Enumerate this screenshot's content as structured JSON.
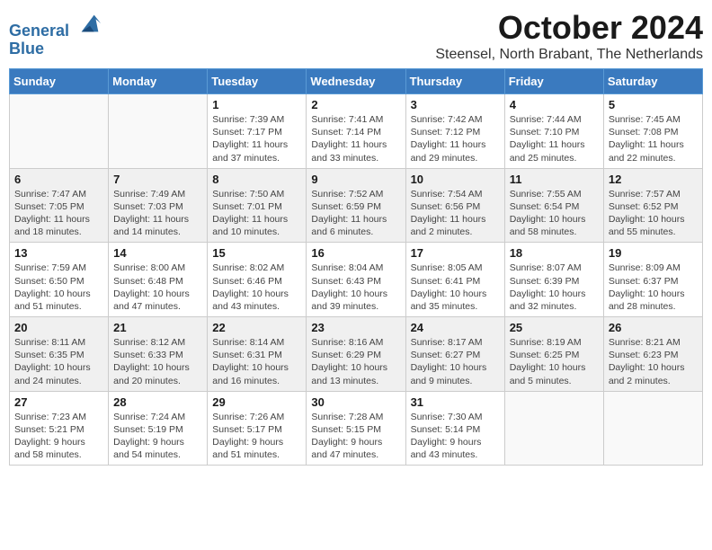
{
  "logo": {
    "line1": "General",
    "line2": "Blue"
  },
  "title": "October 2024",
  "location": "Steensel, North Brabant, The Netherlands",
  "days_of_week": [
    "Sunday",
    "Monday",
    "Tuesday",
    "Wednesday",
    "Thursday",
    "Friday",
    "Saturday"
  ],
  "weeks": [
    [
      {
        "day": "",
        "empty": true
      },
      {
        "day": "",
        "empty": true
      },
      {
        "day": "1",
        "rise": "7:39 AM",
        "set": "7:17 PM",
        "daylight": "11 hours and 37 minutes."
      },
      {
        "day": "2",
        "rise": "7:41 AM",
        "set": "7:14 PM",
        "daylight": "11 hours and 33 minutes."
      },
      {
        "day": "3",
        "rise": "7:42 AM",
        "set": "7:12 PM",
        "daylight": "11 hours and 29 minutes."
      },
      {
        "day": "4",
        "rise": "7:44 AM",
        "set": "7:10 PM",
        "daylight": "11 hours and 25 minutes."
      },
      {
        "day": "5",
        "rise": "7:45 AM",
        "set": "7:08 PM",
        "daylight": "11 hours and 22 minutes."
      }
    ],
    [
      {
        "day": "6",
        "rise": "7:47 AM",
        "set": "7:05 PM",
        "daylight": "11 hours and 18 minutes."
      },
      {
        "day": "7",
        "rise": "7:49 AM",
        "set": "7:03 PM",
        "daylight": "11 hours and 14 minutes."
      },
      {
        "day": "8",
        "rise": "7:50 AM",
        "set": "7:01 PM",
        "daylight": "11 hours and 10 minutes."
      },
      {
        "day": "9",
        "rise": "7:52 AM",
        "set": "6:59 PM",
        "daylight": "11 hours and 6 minutes."
      },
      {
        "day": "10",
        "rise": "7:54 AM",
        "set": "6:56 PM",
        "daylight": "11 hours and 2 minutes."
      },
      {
        "day": "11",
        "rise": "7:55 AM",
        "set": "6:54 PM",
        "daylight": "10 hours and 58 minutes."
      },
      {
        "day": "12",
        "rise": "7:57 AM",
        "set": "6:52 PM",
        "daylight": "10 hours and 55 minutes."
      }
    ],
    [
      {
        "day": "13",
        "rise": "7:59 AM",
        "set": "6:50 PM",
        "daylight": "10 hours and 51 minutes."
      },
      {
        "day": "14",
        "rise": "8:00 AM",
        "set": "6:48 PM",
        "daylight": "10 hours and 47 minutes."
      },
      {
        "day": "15",
        "rise": "8:02 AM",
        "set": "6:46 PM",
        "daylight": "10 hours and 43 minutes."
      },
      {
        "day": "16",
        "rise": "8:04 AM",
        "set": "6:43 PM",
        "daylight": "10 hours and 39 minutes."
      },
      {
        "day": "17",
        "rise": "8:05 AM",
        "set": "6:41 PM",
        "daylight": "10 hours and 35 minutes."
      },
      {
        "day": "18",
        "rise": "8:07 AM",
        "set": "6:39 PM",
        "daylight": "10 hours and 32 minutes."
      },
      {
        "day": "19",
        "rise": "8:09 AM",
        "set": "6:37 PM",
        "daylight": "10 hours and 28 minutes."
      }
    ],
    [
      {
        "day": "20",
        "rise": "8:11 AM",
        "set": "6:35 PM",
        "daylight": "10 hours and 24 minutes."
      },
      {
        "day": "21",
        "rise": "8:12 AM",
        "set": "6:33 PM",
        "daylight": "10 hours and 20 minutes."
      },
      {
        "day": "22",
        "rise": "8:14 AM",
        "set": "6:31 PM",
        "daylight": "10 hours and 16 minutes."
      },
      {
        "day": "23",
        "rise": "8:16 AM",
        "set": "6:29 PM",
        "daylight": "10 hours and 13 minutes."
      },
      {
        "day": "24",
        "rise": "8:17 AM",
        "set": "6:27 PM",
        "daylight": "10 hours and 9 minutes."
      },
      {
        "day": "25",
        "rise": "8:19 AM",
        "set": "6:25 PM",
        "daylight": "10 hours and 5 minutes."
      },
      {
        "day": "26",
        "rise": "8:21 AM",
        "set": "6:23 PM",
        "daylight": "10 hours and 2 minutes."
      }
    ],
    [
      {
        "day": "27",
        "rise": "7:23 AM",
        "set": "5:21 PM",
        "daylight": "9 hours and 58 minutes."
      },
      {
        "day": "28",
        "rise": "7:24 AM",
        "set": "5:19 PM",
        "daylight": "9 hours and 54 minutes."
      },
      {
        "day": "29",
        "rise": "7:26 AM",
        "set": "5:17 PM",
        "daylight": "9 hours and 51 minutes."
      },
      {
        "day": "30",
        "rise": "7:28 AM",
        "set": "5:15 PM",
        "daylight": "9 hours and 47 minutes."
      },
      {
        "day": "31",
        "rise": "7:30 AM",
        "set": "5:14 PM",
        "daylight": "9 hours and 43 minutes."
      },
      {
        "day": "",
        "empty": true
      },
      {
        "day": "",
        "empty": true
      }
    ]
  ]
}
